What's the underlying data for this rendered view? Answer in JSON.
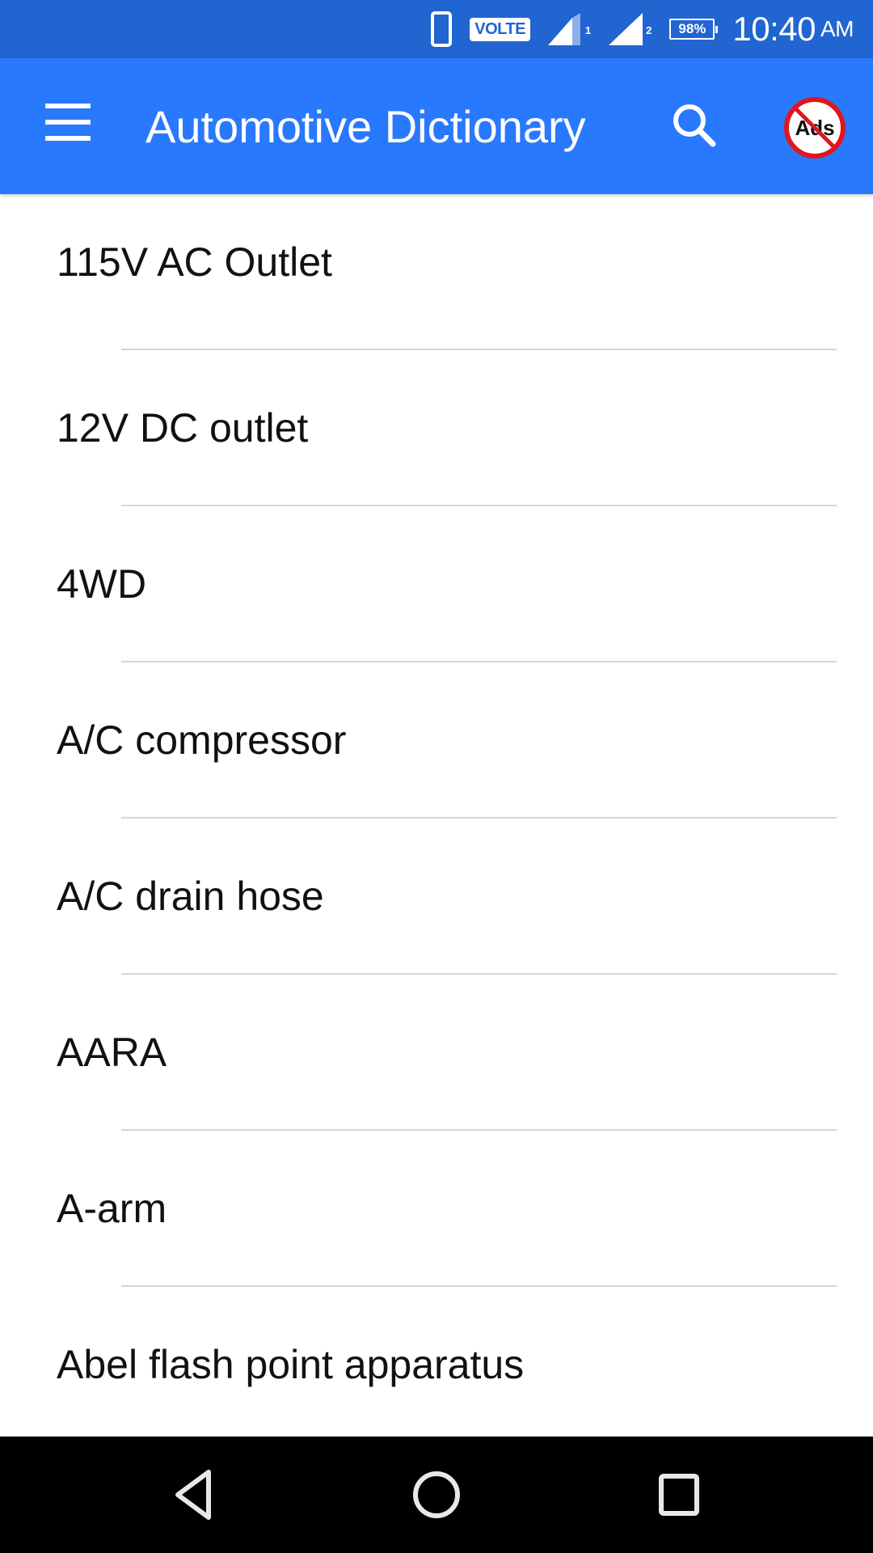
{
  "status_bar": {
    "phone_icon": "phone-outline-icon",
    "volte_label": "VOLTE",
    "sim1_label": "1",
    "sim2_label": "2",
    "battery_label": "98%",
    "battery_level_percent": 98,
    "time": "10:40",
    "ampm": "AM"
  },
  "app_bar": {
    "title": "Automotive Dictionary",
    "menu_icon": "hamburger-menu-icon",
    "search_icon": "search-icon",
    "no_ads_label": "Ads"
  },
  "colors": {
    "status_bar": "#2165d1",
    "app_bar": "#2979ff",
    "no_ads_red": "#e0161f",
    "divider": "#d6d6d6",
    "nav_bar": "#000000"
  },
  "terms": [
    {
      "label": "115V AC Outlet"
    },
    {
      "label": "12V DC outlet"
    },
    {
      "label": "4WD"
    },
    {
      "label": "A/C compressor"
    },
    {
      "label": "A/C drain hose"
    },
    {
      "label": "AARA"
    },
    {
      "label": "A-arm"
    },
    {
      "label": "Abel flash point apparatus"
    }
  ],
  "nav_bar": {
    "back": "back-icon",
    "home": "home-icon",
    "recents": "recents-icon"
  }
}
